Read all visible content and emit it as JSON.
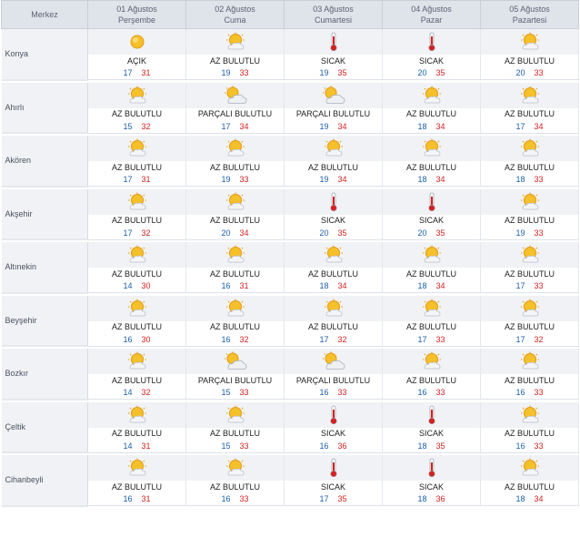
{
  "header": {
    "merkez": "Merkez",
    "days": [
      {
        "date": "01 Ağustos",
        "day": "Perşembe"
      },
      {
        "date": "02 Ağustos",
        "day": "Cuma"
      },
      {
        "date": "03 Ağustos",
        "day": "Cumartesi"
      },
      {
        "date": "04 Ağustos",
        "day": "Pazar"
      },
      {
        "date": "05 Ağustos",
        "day": "Pazartesi"
      }
    ]
  },
  "icons": {
    "ACIK": "sun-icon",
    "AZ": "sun-small-cloud-icon",
    "PARCALI": "partly-cloudy-icon",
    "SICAK": "thermometer-icon"
  },
  "colors": {
    "low_temp": "#1a5fb0",
    "high_temp": "#d62020",
    "header_bg": "#dfe3ea"
  },
  "cities": [
    {
      "name": "Konya",
      "days": [
        {
          "cond": "AÇIK",
          "icon": "ACIK",
          "low": "17",
          "high": "31"
        },
        {
          "cond": "AZ BULUTLU",
          "icon": "AZ",
          "low": "19",
          "high": "33"
        },
        {
          "cond": "SICAK",
          "icon": "SICAK",
          "low": "19",
          "high": "35"
        },
        {
          "cond": "SICAK",
          "icon": "SICAK",
          "low": "20",
          "high": "35"
        },
        {
          "cond": "AZ BULUTLU",
          "icon": "AZ",
          "low": "20",
          "high": "33"
        }
      ]
    },
    {
      "name": "Ahırlı",
      "days": [
        {
          "cond": "AZ BULUTLU",
          "icon": "AZ",
          "low": "15",
          "high": "32"
        },
        {
          "cond": "PARÇALI BULUTLU",
          "icon": "PARCALI",
          "low": "17",
          "high": "34"
        },
        {
          "cond": "PARÇALI BULUTLU",
          "icon": "PARCALI",
          "low": "19",
          "high": "34"
        },
        {
          "cond": "AZ BULUTLU",
          "icon": "AZ",
          "low": "18",
          "high": "34"
        },
        {
          "cond": "AZ BULUTLU",
          "icon": "AZ",
          "low": "17",
          "high": "34"
        }
      ]
    },
    {
      "name": "Akören",
      "days": [
        {
          "cond": "AZ BULUTLU",
          "icon": "AZ",
          "low": "17",
          "high": "31"
        },
        {
          "cond": "AZ BULUTLU",
          "icon": "AZ",
          "low": "19",
          "high": "33"
        },
        {
          "cond": "AZ BULUTLU",
          "icon": "AZ",
          "low": "19",
          "high": "34"
        },
        {
          "cond": "AZ BULUTLU",
          "icon": "AZ",
          "low": "18",
          "high": "34"
        },
        {
          "cond": "AZ BULUTLU",
          "icon": "AZ",
          "low": "18",
          "high": "33"
        }
      ]
    },
    {
      "name": "Akşehir",
      "days": [
        {
          "cond": "AZ BULUTLU",
          "icon": "AZ",
          "low": "17",
          "high": "32"
        },
        {
          "cond": "AZ BULUTLU",
          "icon": "AZ",
          "low": "20",
          "high": "34"
        },
        {
          "cond": "SICAK",
          "icon": "SICAK",
          "low": "20",
          "high": "35"
        },
        {
          "cond": "SICAK",
          "icon": "SICAK",
          "low": "20",
          "high": "35"
        },
        {
          "cond": "AZ BULUTLU",
          "icon": "AZ",
          "low": "19",
          "high": "33"
        }
      ]
    },
    {
      "name": "Altınekin",
      "days": [
        {
          "cond": "AZ BULUTLU",
          "icon": "AZ",
          "low": "14",
          "high": "30"
        },
        {
          "cond": "AZ BULUTLU",
          "icon": "AZ",
          "low": "16",
          "high": "31"
        },
        {
          "cond": "AZ BULUTLU",
          "icon": "AZ",
          "low": "18",
          "high": "34"
        },
        {
          "cond": "AZ BULUTLU",
          "icon": "AZ",
          "low": "18",
          "high": "34"
        },
        {
          "cond": "AZ BULUTLU",
          "icon": "AZ",
          "low": "17",
          "high": "33"
        }
      ]
    },
    {
      "name": "Beyşehir",
      "days": [
        {
          "cond": "AZ BULUTLU",
          "icon": "AZ",
          "low": "16",
          "high": "30"
        },
        {
          "cond": "AZ BULUTLU",
          "icon": "AZ",
          "low": "16",
          "high": "32"
        },
        {
          "cond": "AZ BULUTLU",
          "icon": "AZ",
          "low": "17",
          "high": "32"
        },
        {
          "cond": "AZ BULUTLU",
          "icon": "AZ",
          "low": "17",
          "high": "33"
        },
        {
          "cond": "AZ BULUTLU",
          "icon": "AZ",
          "low": "17",
          "high": "32"
        }
      ]
    },
    {
      "name": "Bozkır",
      "days": [
        {
          "cond": "AZ BULUTLU",
          "icon": "AZ",
          "low": "14",
          "high": "32"
        },
        {
          "cond": "PARÇALI BULUTLU",
          "icon": "PARCALI",
          "low": "15",
          "high": "33"
        },
        {
          "cond": "PARÇALI BULUTLU",
          "icon": "PARCALI",
          "low": "16",
          "high": "33"
        },
        {
          "cond": "AZ BULUTLU",
          "icon": "AZ",
          "low": "16",
          "high": "33"
        },
        {
          "cond": "AZ BULUTLU",
          "icon": "AZ",
          "low": "16",
          "high": "33"
        }
      ]
    },
    {
      "name": "Çeltik",
      "days": [
        {
          "cond": "AZ BULUTLU",
          "icon": "AZ",
          "low": "14",
          "high": "31"
        },
        {
          "cond": "AZ BULUTLU",
          "icon": "AZ",
          "low": "15",
          "high": "33"
        },
        {
          "cond": "SICAK",
          "icon": "SICAK",
          "low": "16",
          "high": "36"
        },
        {
          "cond": "SICAK",
          "icon": "SICAK",
          "low": "18",
          "high": "35"
        },
        {
          "cond": "AZ BULUTLU",
          "icon": "AZ",
          "low": "16",
          "high": "33"
        }
      ]
    },
    {
      "name": "Cihanbeyli",
      "days": [
        {
          "cond": "AZ BULUTLU",
          "icon": "AZ",
          "low": "16",
          "high": "31"
        },
        {
          "cond": "AZ BULUTLU",
          "icon": "AZ",
          "low": "16",
          "high": "33"
        },
        {
          "cond": "SICAK",
          "icon": "SICAK",
          "low": "17",
          "high": "35"
        },
        {
          "cond": "SICAK",
          "icon": "SICAK",
          "low": "18",
          "high": "36"
        },
        {
          "cond": "AZ BULUTLU",
          "icon": "AZ",
          "low": "18",
          "high": "34"
        }
      ]
    }
  ]
}
